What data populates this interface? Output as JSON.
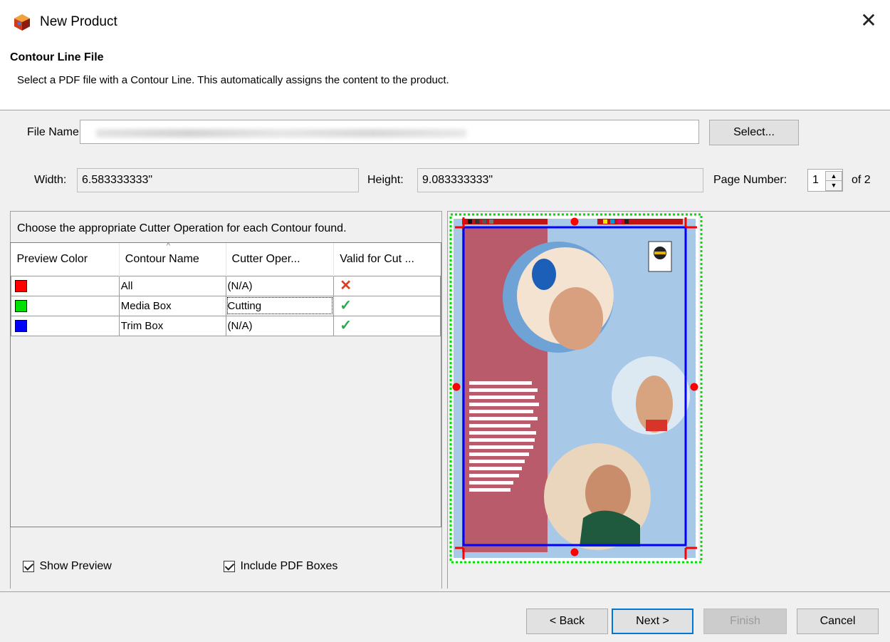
{
  "window": {
    "title": "New Product"
  },
  "header": {
    "title": "Contour Line File",
    "description": "Select a PDF file with a Contour Line. This automatically assigns the content to the product."
  },
  "file": {
    "label": "File Name:",
    "value": "",
    "select_label": "Select..."
  },
  "dims": {
    "width_label": "Width:",
    "width_value": "6.583333333\"",
    "height_label": "Height:",
    "height_value": "9.083333333\""
  },
  "page": {
    "label": "Page Number:",
    "value": "1",
    "of_label": "of 2"
  },
  "contours": {
    "instruction": "Choose the appropriate Cutter Operation for each Contour found.",
    "columns": [
      "Preview Color",
      "Contour Name",
      "Cutter Oper...",
      "Valid for Cut ..."
    ],
    "rows": [
      {
        "color": "#ff0000",
        "name": "All",
        "operation": "(N/A)",
        "valid": "✕",
        "valid_color": "#e03c1e"
      },
      {
        "color": "#00e000",
        "name": "Media Box",
        "operation": "Cutting",
        "valid": "✓",
        "valid_color": "#2fa84f"
      },
      {
        "color": "#0000ff",
        "name": "Trim Box",
        "operation": "(N/A)",
        "valid": "✓",
        "valid_color": "#2fa84f"
      }
    ]
  },
  "options": {
    "show_preview_label": "Show Preview",
    "include_pdf_boxes_label": "Include PDF Boxes"
  },
  "buttons": {
    "back": "< Back",
    "next": "Next >",
    "finish": "Finish",
    "cancel": "Cancel"
  }
}
